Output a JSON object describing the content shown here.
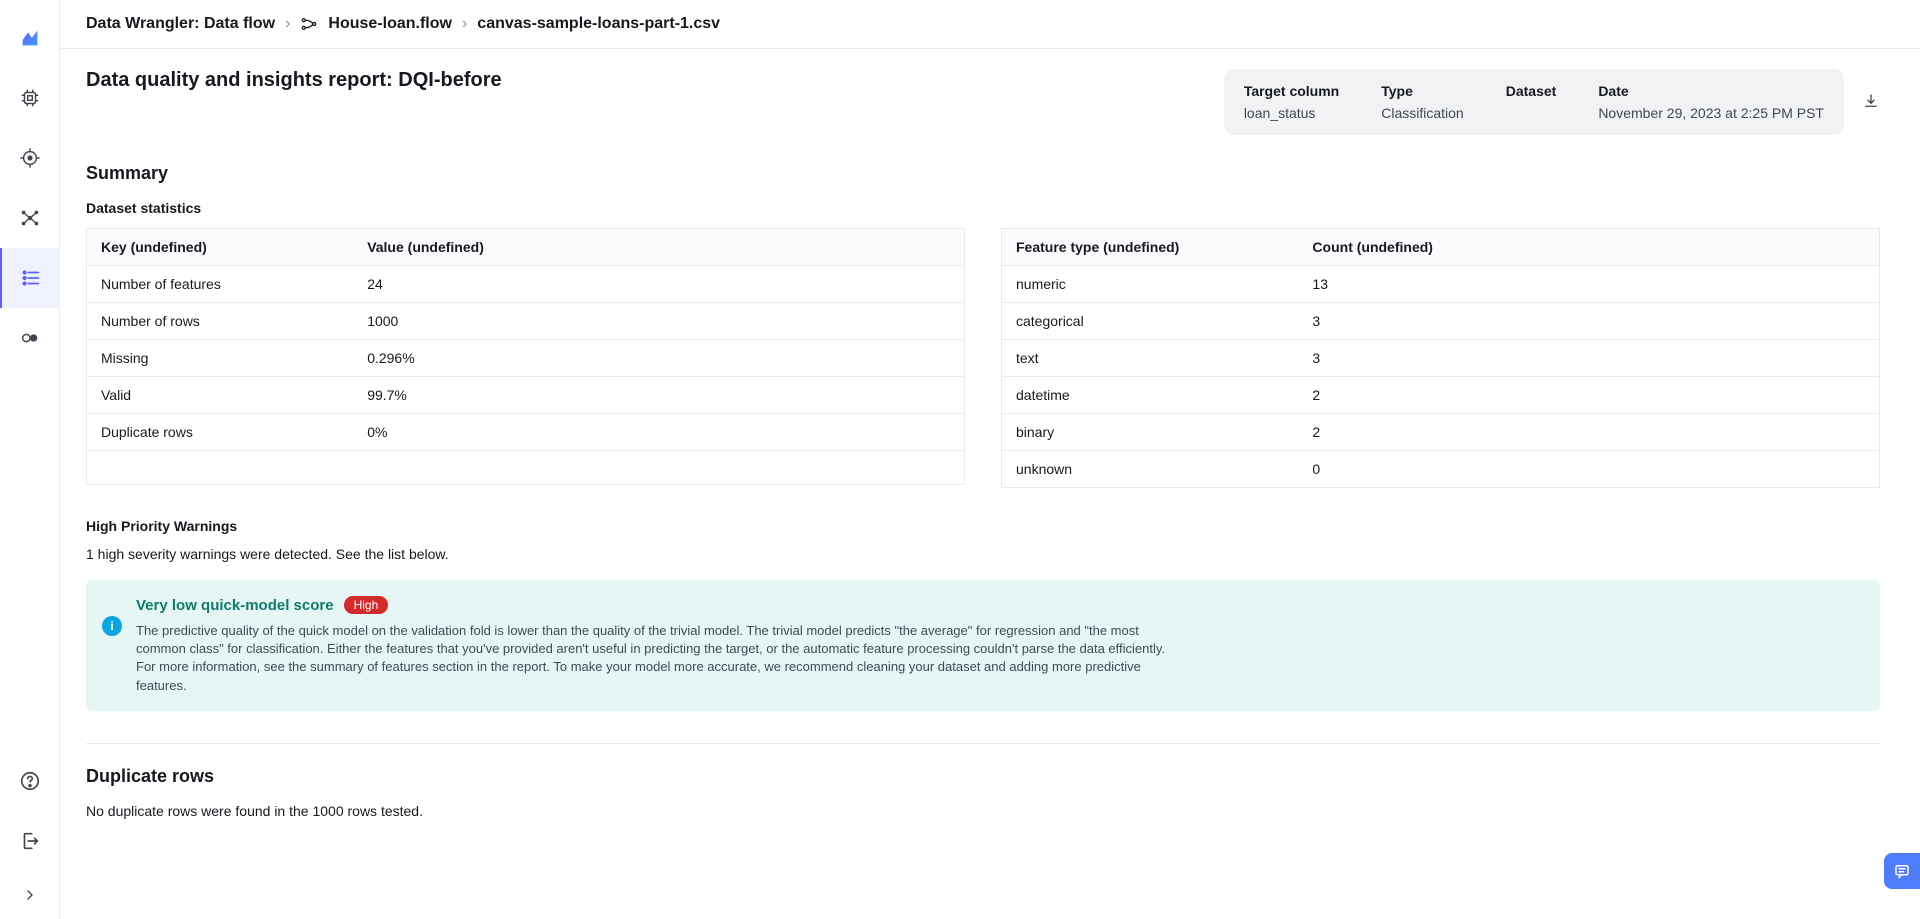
{
  "breadcrumb": {
    "root": "Data Wrangler: Data flow",
    "flow": "House-loan.flow",
    "file": "canvas-sample-loans-part-1.csv"
  },
  "page_title": "Data quality and insights report: DQI-before",
  "info_card": {
    "labels": {
      "target": "Target column",
      "type": "Type",
      "dataset": "Dataset",
      "date": "Date"
    },
    "values": {
      "target": "loan_status",
      "type": "Classification",
      "dataset": "",
      "date": "November 29, 2023 at 2:25 PM PST"
    }
  },
  "summary": {
    "heading": "Summary",
    "stats_heading": "Dataset statistics",
    "left_table": {
      "cols": [
        "Key (undefined)",
        "Value (undefined)"
      ],
      "rows": [
        [
          "Number of features",
          "24"
        ],
        [
          "Number of rows",
          "1000"
        ],
        [
          "Missing",
          "0.296%"
        ],
        [
          "Valid",
          "99.7%"
        ],
        [
          "Duplicate rows",
          "0%"
        ]
      ]
    },
    "right_table": {
      "cols": [
        "Feature type (undefined)",
        "Count (undefined)"
      ],
      "rows": [
        [
          "numeric",
          "13"
        ],
        [
          "categorical",
          "3"
        ],
        [
          "text",
          "3"
        ],
        [
          "datetime",
          "2"
        ],
        [
          "binary",
          "2"
        ],
        [
          "unknown",
          "0"
        ]
      ]
    }
  },
  "warnings": {
    "heading": "High Priority Warnings",
    "intro": "1 high severity warnings were detected. See the list below.",
    "alert_title": "Very low quick-model score",
    "badge": "High",
    "alert_body": "The predictive quality of the quick model on the validation fold is lower than the quality of the trivial model. The trivial model predicts \"the average\" for regression and \"the most common class\" for classification. Either the features that you've provided aren't useful in predicting the target, or the automatic feature processing couldn't parse the data efficiently. For more information, see the summary of features section in the report. To make your model more accurate, we recommend cleaning your dataset and adding more predictive features."
  },
  "duplicates": {
    "heading": "Duplicate rows",
    "text": "No duplicate rows were found in the 1000 rows tested."
  }
}
